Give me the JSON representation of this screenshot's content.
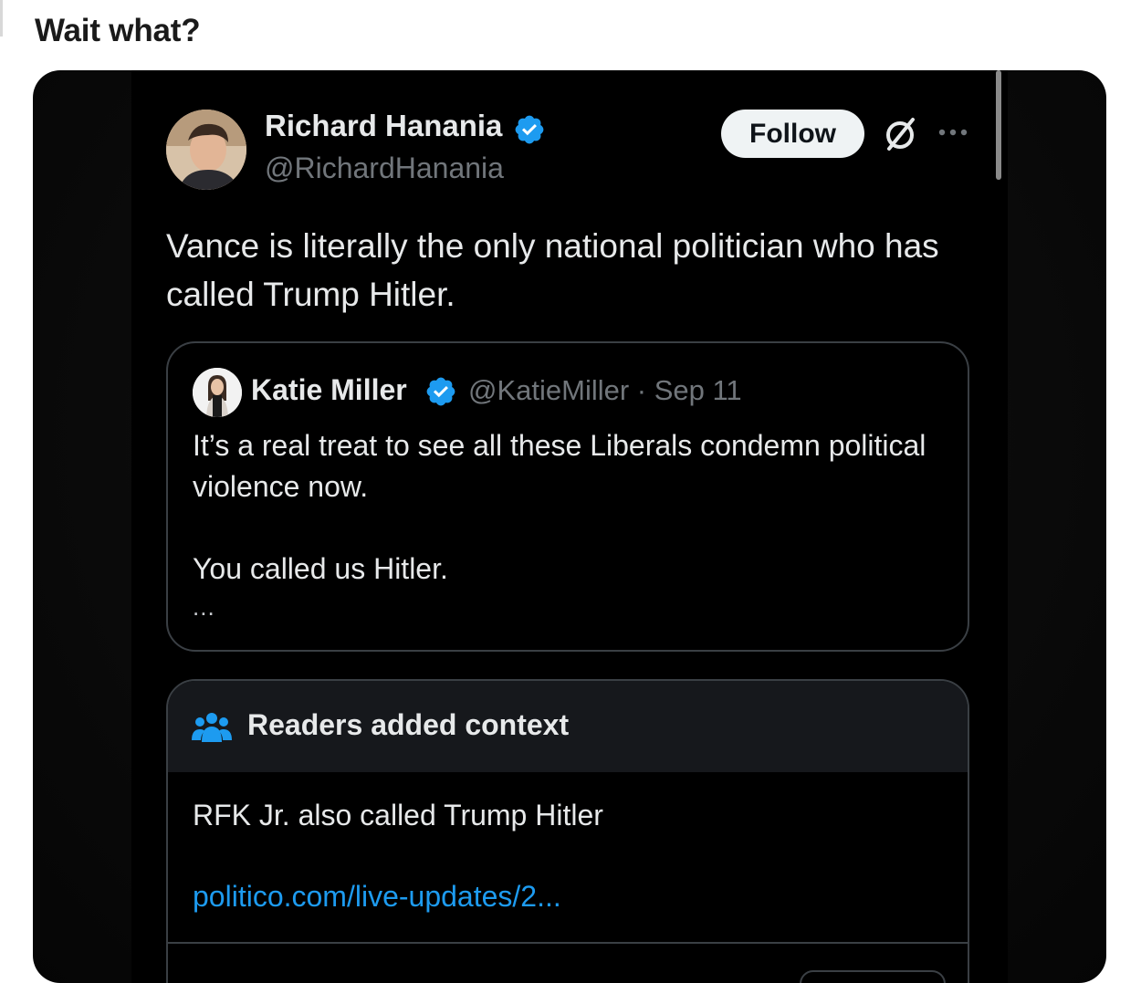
{
  "post": {
    "title": "Wait what?"
  },
  "tweet": {
    "author_name": "Richard Hanania",
    "author_handle": "@RichardHanania",
    "follow_label": "Follow",
    "text": "Vance is literally the only national politician who has called Trump Hitler."
  },
  "quote": {
    "author_name": "Katie Miller",
    "meta": "@KatieMiller · Sep 11",
    "paragraph_1": "It’s a real treat to see all these Liberals condemn political violence now.",
    "paragraph_2": "You called us Hitler.",
    "ellipsis": "..."
  },
  "community_note": {
    "title": "Readers added context",
    "body": "RFK Jr. also called Trump Hitler",
    "link": "politico.com/live-updates/2..."
  },
  "colors": {
    "verified_blue": "#1d9bf0",
    "link_blue": "#1d9bf0",
    "text_primary": "#e7e9ea",
    "text_secondary": "#71767b",
    "background": "#000000"
  },
  "icons": {
    "verified": "verified-badge-icon",
    "grok": "grok-icon",
    "more": "more-options-icon",
    "community_notes": "people-group-icon"
  }
}
